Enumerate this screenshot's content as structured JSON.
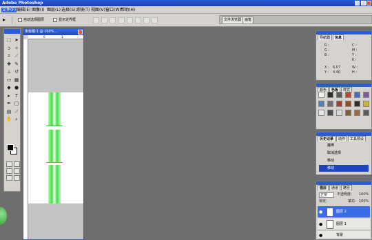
{
  "app": {
    "title": "Adobe Photoshop"
  },
  "menu": [
    "文件(F)",
    "编辑(E)",
    "图像(I)",
    "图层(L)",
    "选择(S)",
    "滤镜(T)",
    "视图(V)",
    "窗口(W)",
    "帮助(H)"
  ],
  "options": {
    "auto_select_label": "自动选择图层",
    "show_bounds_label": "显示定界框",
    "palette_well_tabs": [
      "文件浏览器",
      "画笔"
    ]
  },
  "document": {
    "title": "未标题-1 @ 100%...",
    "ruler_marks": [
      "0",
      "1"
    ]
  },
  "navigator": {
    "tabs": [
      "导航器",
      "信息"
    ],
    "rgb_labels": [
      "R :",
      "G :",
      "B :"
    ],
    "cmyk_labels": [
      "C :",
      "M :",
      "Y :",
      "K :"
    ],
    "x_label": "X :",
    "x_value": "6.07",
    "y_label": "Y :",
    "y_value": "4.40",
    "w_label": "W :",
    "h_label": "H :"
  },
  "swatches": {
    "tabs": [
      "颜色",
      "色板",
      "样式"
    ],
    "colors": [
      "#f2f2f2",
      "#2e2e2e",
      "#5a5a5a",
      "#b24a3a",
      "#3d6fc4",
      "#7f5b9a",
      "#4f7fc9",
      "#6f6f6f",
      "#a33f2f",
      "#8c4f2a",
      "#2f2f2f",
      "#c9b23a",
      "#e8e8e8",
      "#4a4a4a",
      "#d9d9d9",
      "#7a5f3a",
      "#9c6b3e",
      "#5c5c5c"
    ]
  },
  "history": {
    "tabs": [
      "历史记录",
      "动作",
      "工具预设"
    ],
    "items": [
      {
        "label": "魔棒",
        "selected": false
      },
      {
        "label": "取消选择",
        "selected": false
      },
      {
        "label": "移动",
        "selected": false
      },
      {
        "label": "移动",
        "selected": true
      }
    ]
  },
  "layers": {
    "tabs": [
      "图层",
      "通道",
      "路径"
    ],
    "blend_mode": "正常",
    "opacity_label": "不透明度:",
    "opacity_value": "100%",
    "lock_label": "锁定:",
    "fill_label": "填充:",
    "fill_value": "100%",
    "items": [
      {
        "name": "图层 2",
        "selected": true
      },
      {
        "name": "图层 1",
        "selected": false
      },
      {
        "name": "背景",
        "selected": false
      }
    ]
  }
}
